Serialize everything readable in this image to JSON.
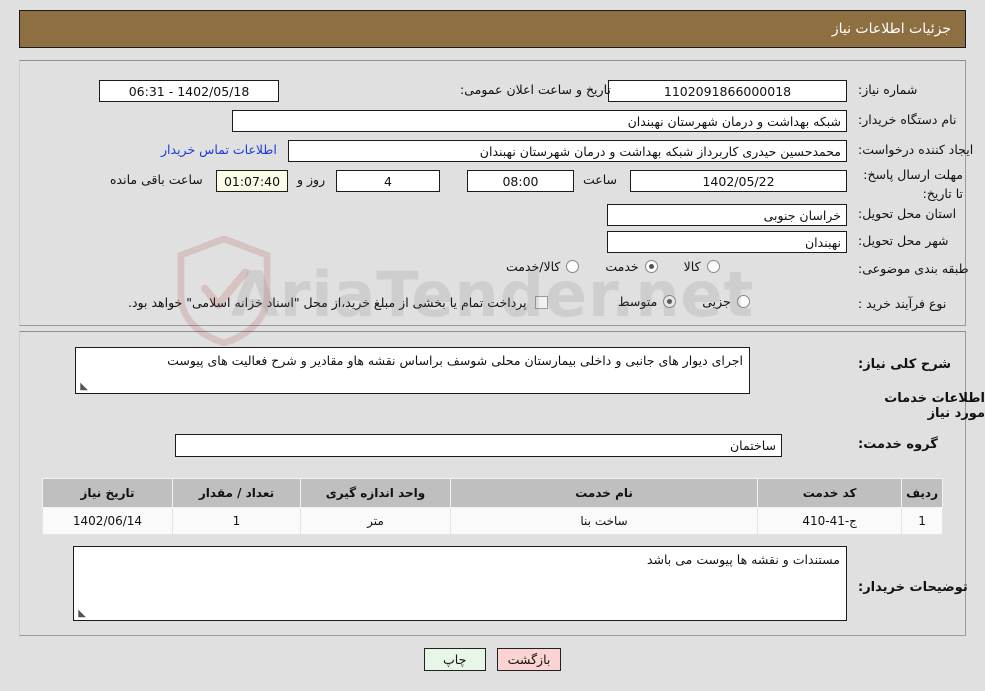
{
  "header": {
    "title": "جزئیات اطلاعات نیاز"
  },
  "form": {
    "need_number_label": "شماره نیاز:",
    "need_number_value": "1102091866000018",
    "public_announce_label": "تاریخ و ساعت اعلان عمومی:",
    "public_announce_value": "1402/05/18 - 06:31",
    "buyer_org_label": "نام دستگاه خریدار:",
    "buyer_org_value": "شبکه بهداشت و درمان شهرستان نهبندان",
    "creator_label": "ایجاد کننده درخواست:",
    "creator_value": "محمدحسین حیدری کاربرداز شبکه بهداشت و درمان شهرستان نهبندان",
    "contact_link": "اطلاعات تماس خریدار",
    "deadline_label": "مهلت ارسال پاسخ: تا تاریخ:",
    "deadline_date": "1402/05/22",
    "hour_label": "ساعت",
    "deadline_time": "08:00",
    "days_remaining": "4",
    "days_and_label": "روز و",
    "countdown": "01:07:40",
    "hours_remaining_label": "ساعت باقی مانده",
    "province_label": "استان محل تحویل:",
    "province_value": "خراسان جنوبی",
    "city_label": "شهر محل تحویل:",
    "city_value": "نهبندان",
    "category_label": "طبقه بندی موضوعی:",
    "category_options": [
      {
        "label": "کالا",
        "selected": false
      },
      {
        "label": "خدمت",
        "selected": true
      },
      {
        "label": "کالا/خدمت",
        "selected": false
      }
    ],
    "process_label": "نوع فرآیند خرید :",
    "process_options": [
      {
        "label": "جزیی",
        "selected": false
      },
      {
        "label": "متوسط",
        "selected": true
      }
    ],
    "treasury_checkbox_label": "پرداخت تمام یا بخشی از مبلغ خرید،از محل \"اسناد خزانه اسلامی\" خواهد بود.",
    "treasury_checked": false
  },
  "main": {
    "general_desc_label": "شرح کلی نیاز:",
    "general_desc_value": "اجرای دیوار های جانبی و داخلی بیمارستان محلی شوسف براساس نقشه هاو مقادیر و شرح فعالیت های پیوست",
    "services_heading": "اطلاعات خدمات مورد نیاز",
    "service_group_label": "گروه خدمت:",
    "service_group_value": "ساختمان",
    "buyer_notes_label": "توضیحات خریدار:",
    "buyer_notes_value": "مستندات و نقشه ها پیوست می باشد"
  },
  "table": {
    "columns": [
      "ردیف",
      "کد خدمت",
      "نام خدمت",
      "واحد اندازه گیری",
      "تعداد / مقدار",
      "تاریخ نیاز"
    ],
    "rows": [
      {
        "index": "1",
        "service_code": "ج-41-410",
        "service_name": "ساخت بنا",
        "unit": "متر",
        "quantity": "1",
        "need_date": "1402/06/14"
      }
    ]
  },
  "buttons": {
    "print": "چاپ",
    "back": "بازگشت"
  },
  "watermark": {
    "text": "AriaTender.net"
  },
  "colors": {
    "header_bg": "#8d6f41",
    "page_bg": "#e0e0e0",
    "link": "#1b39d8",
    "table_header_bg": "#bfbfbf",
    "print_btn_bg": "#e8f6e8",
    "back_btn_bg": "#fbd3d3",
    "timer_bg": "#fbfbe6"
  }
}
